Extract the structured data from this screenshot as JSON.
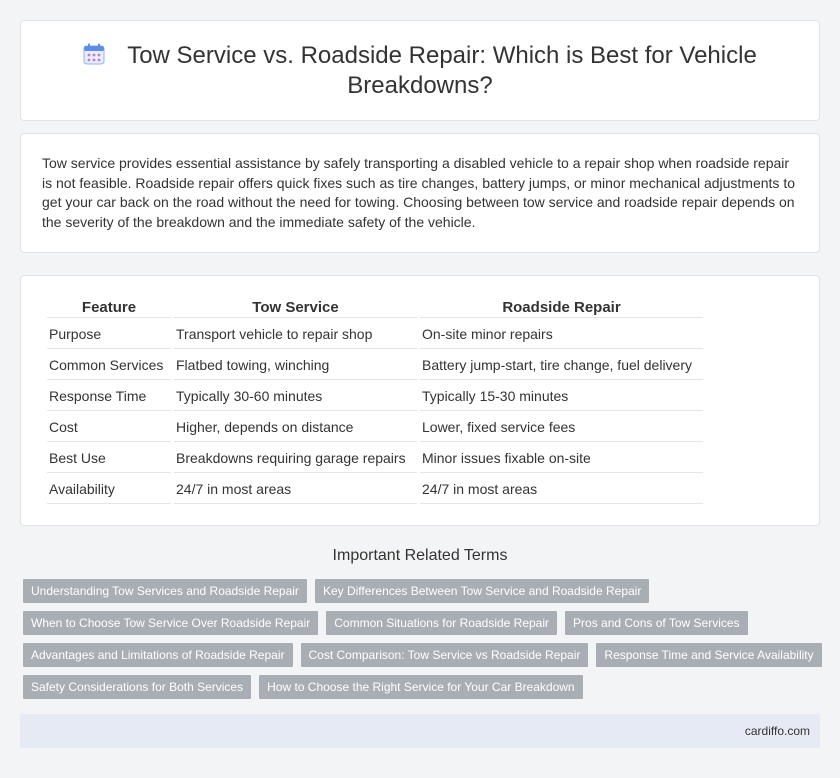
{
  "header": {
    "icon": "calendar-icon",
    "title": "Tow Service vs. Roadside Repair: Which is Best for Vehicle Breakdowns?"
  },
  "intro": {
    "text": "Tow service provides essential assistance by safely transporting a disabled vehicle to a repair shop when roadside repair is not feasible. Roadside repair offers quick fixes such as tire changes, battery jumps, or minor mechanical adjustments to get your car back on the road without the need for towing. Choosing between tow service and roadside repair depends on the severity of the breakdown and the immediate safety of the vehicle."
  },
  "table": {
    "headers": [
      "Feature",
      "Tow Service",
      "Roadside Repair"
    ],
    "rows": [
      [
        "Purpose",
        "Transport vehicle to repair shop",
        "On-site minor repairs"
      ],
      [
        "Common Services",
        "Flatbed towing, winching",
        "Battery jump-start, tire change, fuel delivery"
      ],
      [
        "Response Time",
        "Typically 30-60 minutes",
        "Typically 15-30 minutes"
      ],
      [
        "Cost",
        "Higher, depends on distance",
        "Lower, fixed service fees"
      ],
      [
        "Best Use",
        "Breakdowns requiring garage repairs",
        "Minor issues fixable on-site"
      ],
      [
        "Availability",
        "24/7 in most areas",
        "24/7 in most areas"
      ]
    ]
  },
  "related": {
    "title": "Important Related Terms",
    "rows": [
      [
        "Understanding Tow Services and Roadside Repair",
        "Key Differences Between Tow Service and Roadside Repair"
      ],
      [
        "When to Choose Tow Service Over Roadside Repair",
        "Common Situations for Roadside Repair",
        "Pros and Cons of Tow Services"
      ],
      [
        "Advantages and Limitations of Roadside Repair",
        "Cost Comparison: Tow Service vs Roadside Repair",
        "Response Time and Service Availability"
      ],
      [
        "Safety Considerations for Both Services",
        "How to Choose the Right Service for Your Car Breakdown"
      ]
    ]
  },
  "footer": {
    "site": "cardiffo.com"
  },
  "colors": {
    "tag_bg": "#a9aeb5",
    "footer_bg": "#e5eaf4",
    "page_bg": "#f3f4f6",
    "icon_accent": "#5b8def"
  }
}
